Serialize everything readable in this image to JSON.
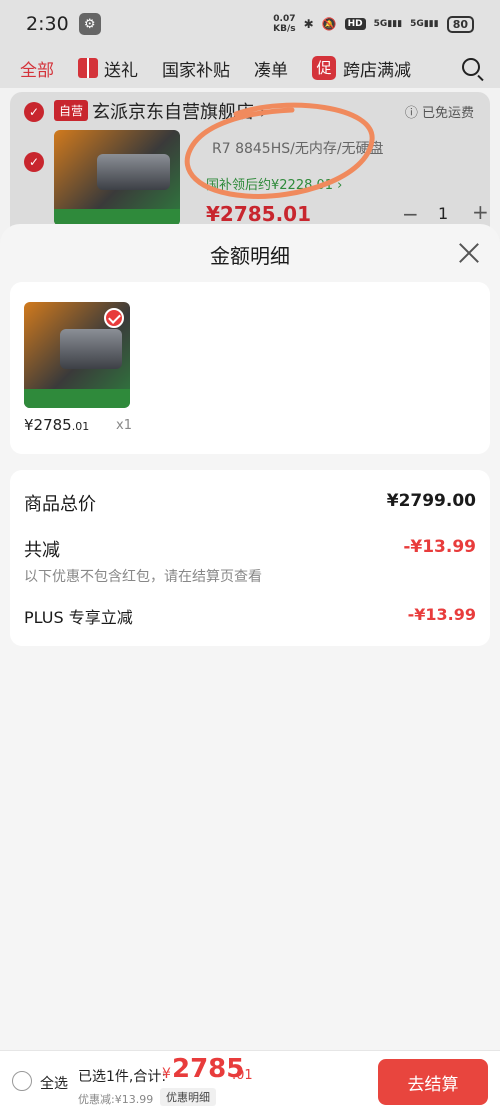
{
  "status_bar": {
    "time": "2:30",
    "net_speed_value": "0.07",
    "net_speed_unit": "KB/s",
    "hd": "HD",
    "sig1": "5G",
    "sig2": "5G",
    "battery": "80"
  },
  "tabs": {
    "all": "全部",
    "gift": "送礼",
    "national_subsidy": "国家补贴",
    "bundle": "凑单",
    "promo_badge": "促",
    "cross_store": "跨店满减"
  },
  "cart": {
    "store_badge": "自营",
    "store_name": "玄派京东自营旗舰店",
    "store_arrow": "›",
    "free_shipping": "ⓘ 已免运费",
    "spec": "R7 8845HS/无内存/无硬盘",
    "subsidy": "国补领后约¥2228.01 ›",
    "price": "¥2785.01",
    "qty_minus": "−",
    "qty": "1",
    "qty_plus": "+"
  },
  "sheet": {
    "title": "金额明细",
    "product": {
      "price_int": "¥2785",
      "price_dec": ".01",
      "qty": "x1"
    },
    "summary": {
      "total_label": "商品总价",
      "total_value": "¥2799.00",
      "reduce_label": "共减",
      "reduce_value": "-¥13.99",
      "note": "以下优惠不包含红包，请在结算页查看",
      "plus_label": "PLUS 专享立减",
      "plus_value": "-¥13.99"
    }
  },
  "bottom": {
    "select_all": "全选",
    "selected": "已选1件,合计:",
    "yen": "¥",
    "total_int": "2785",
    "total_dec": ".01",
    "discount": "优惠减:¥13.99",
    "detail_button": "优惠明细",
    "checkout_button": "去结算"
  },
  "colors": {
    "accent_red": "#e8453e",
    "subsidy_green": "#2f8a3b",
    "annotation_orange": "#f08a5d"
  }
}
